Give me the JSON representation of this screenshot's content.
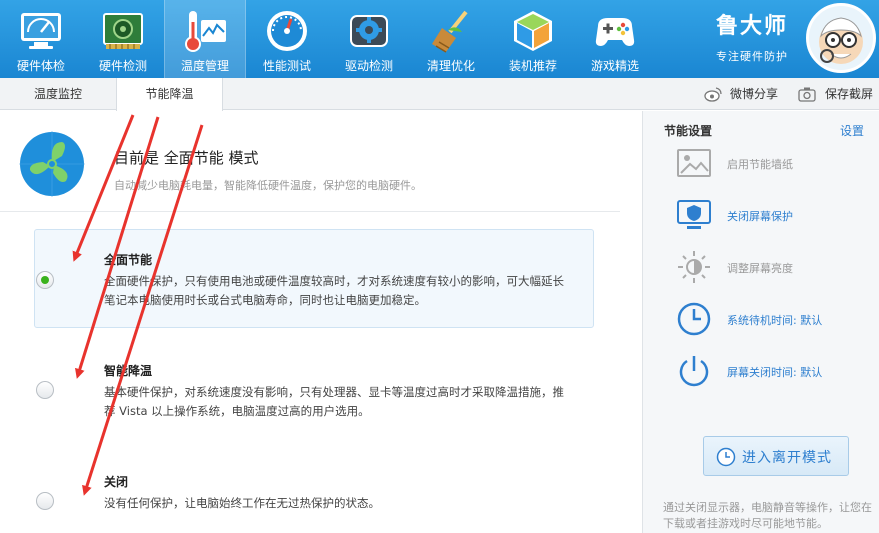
{
  "toolbar": {
    "items": [
      {
        "label": "硬件体检",
        "icon": "monitor-check-icon"
      },
      {
        "label": "硬件检测",
        "icon": "circuit-board-icon"
      },
      {
        "label": "温度管理",
        "icon": "thermometer-chart-icon"
      },
      {
        "label": "性能测试",
        "icon": "speedometer-icon"
      },
      {
        "label": "驱动检测",
        "icon": "driver-gear-icon"
      },
      {
        "label": "清理优化",
        "icon": "broom-icon"
      },
      {
        "label": "装机推荐",
        "icon": "cube-icon"
      },
      {
        "label": "游戏精选",
        "icon": "gamepad-icon"
      }
    ],
    "active_index": 2
  },
  "brand": {
    "name": "鲁大师",
    "slogan": "专注硬件防护"
  },
  "tabs": [
    {
      "label": "温度监控"
    },
    {
      "label": "节能降温"
    }
  ],
  "share": {
    "weibo_label": "微博分享",
    "screenshot_label": "保存截屏"
  },
  "main": {
    "mode_title": "目前是 全面节能 模式",
    "mode_desc": "自动减少电脑耗电量，智能降低硬件温度，保护您的电脑硬件。",
    "options": [
      {
        "title": "全面节能",
        "desc": "全面硬件保护，只有使用电池或硬件温度较高时，才对系统速度有较小的影响，可大幅延长笔记本电脑使用时长或台式电脑寿命，同时也让电脑更加稳定。",
        "selected": true
      },
      {
        "title": "智能降温",
        "desc": "基本硬件保护，对系统速度没有影响，只有处理器、显卡等温度过高时才采取降温措施，推荐 Vista 以上操作系统，电脑温度过高的用户选用。",
        "selected": false
      },
      {
        "title": "关闭",
        "desc": "没有任何保护，让电脑始终工作在无过热保护的状态。",
        "selected": false
      }
    ]
  },
  "sidebar": {
    "title": "节能设置",
    "settings_link": "设置",
    "items": [
      {
        "label": "启用节能墙纸",
        "icon": "wallpaper-icon",
        "enabled": false
      },
      {
        "label": "关闭屏幕保护",
        "icon": "screen-shield-icon",
        "enabled": true
      },
      {
        "label": "调整屏幕亮度",
        "icon": "brightness-icon",
        "enabled": false
      },
      {
        "label": "系统待机时间: 默认",
        "icon": "standby-clock-icon",
        "enabled": true
      },
      {
        "label": "屏幕关闭时间: 默认",
        "icon": "power-icon",
        "enabled": true
      }
    ],
    "away_button": "进入离开模式",
    "note": "通过关闭显示器，电脑静音等操作，让您在下载或者挂游戏时尽可能地节能。"
  },
  "colors": {
    "toolbar": "#1f8fdb",
    "link": "#2e7fcf",
    "selected_radio": "#3ab21c",
    "arrow": "#e8332d"
  }
}
